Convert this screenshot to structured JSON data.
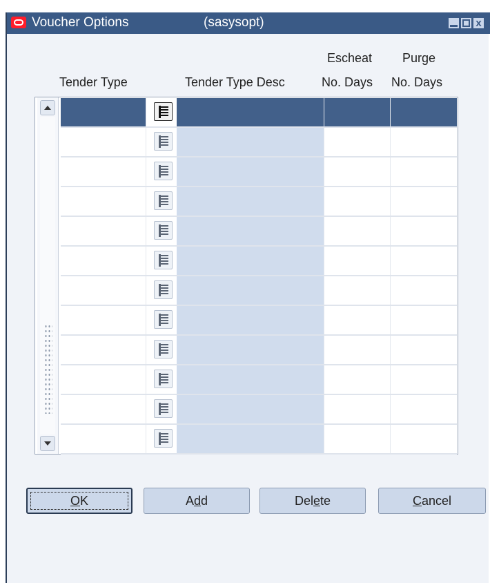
{
  "window": {
    "title": "Voucher Options",
    "form_code": "(sasysopt)",
    "close_glyph": "x"
  },
  "columns": {
    "tender_type": "Tender Type",
    "tender_type_desc": "Tender Type Desc",
    "escheat_line1": "Escheat",
    "escheat_line2": "No. Days",
    "purge_line1": "Purge",
    "purge_line2": "No. Days"
  },
  "grid": {
    "row_count": 12,
    "selected_row": 0,
    "rows": [
      {
        "tender_type": "",
        "desc": "",
        "escheat_days": "",
        "purge_days": ""
      },
      {
        "tender_type": "",
        "desc": "",
        "escheat_days": "",
        "purge_days": ""
      },
      {
        "tender_type": "",
        "desc": "",
        "escheat_days": "",
        "purge_days": ""
      },
      {
        "tender_type": "",
        "desc": "",
        "escheat_days": "",
        "purge_days": ""
      },
      {
        "tender_type": "",
        "desc": "",
        "escheat_days": "",
        "purge_days": ""
      },
      {
        "tender_type": "",
        "desc": "",
        "escheat_days": "",
        "purge_days": ""
      },
      {
        "tender_type": "",
        "desc": "",
        "escheat_days": "",
        "purge_days": ""
      },
      {
        "tender_type": "",
        "desc": "",
        "escheat_days": "",
        "purge_days": ""
      },
      {
        "tender_type": "",
        "desc": "",
        "escheat_days": "",
        "purge_days": ""
      },
      {
        "tender_type": "",
        "desc": "",
        "escheat_days": "",
        "purge_days": ""
      },
      {
        "tender_type": "",
        "desc": "",
        "escheat_days": "",
        "purge_days": ""
      },
      {
        "tender_type": "",
        "desc": "",
        "escheat_days": "",
        "purge_days": ""
      }
    ]
  },
  "buttons": {
    "ok": {
      "pre": "",
      "key": "O",
      "post": "K"
    },
    "add": {
      "pre": "A",
      "key": "d",
      "post": "d"
    },
    "delete": {
      "pre": "Del",
      "key": "e",
      "post": "te"
    },
    "cancel": {
      "pre": "",
      "key": "C",
      "post": "ancel"
    }
  },
  "colors": {
    "titlebar": "#3a5a86",
    "selected_row": "#42608a",
    "desc_column": "#d0dced",
    "button_face": "#ccd8ea",
    "oracle_logo": "#ff1d2a"
  },
  "icons": {
    "logo": "oracle-logo-icon",
    "lov": "list-of-values-icon",
    "minimize": "minimize-icon",
    "maximize": "maximize-icon",
    "close": "close-icon",
    "scroll_up": "scroll-up-arrow-icon",
    "scroll_down": "scroll-down-arrow-icon"
  }
}
